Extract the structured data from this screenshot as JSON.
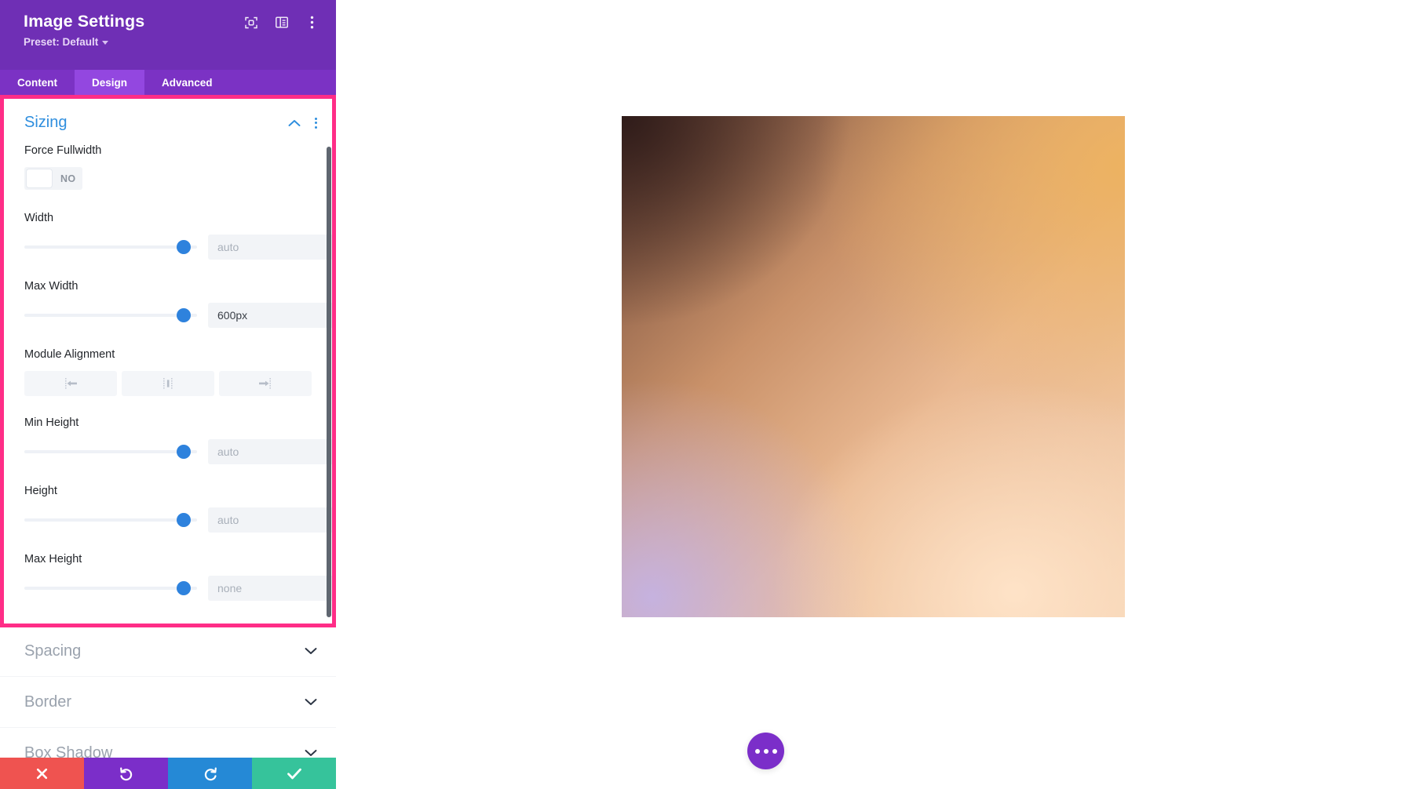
{
  "panel": {
    "title": "Image Settings",
    "preset_label": "Preset: Default",
    "header_icons": [
      {
        "name": "target-focus-icon"
      },
      {
        "name": "layout-panel-icon"
      },
      {
        "name": "kebab-menu-icon"
      }
    ],
    "tabs": [
      {
        "label": "Content",
        "active": false
      },
      {
        "label": "Design",
        "active": true
      },
      {
        "label": "Advanced",
        "active": false
      }
    ],
    "highlight_color": "#ff2d87",
    "accent_color": "#2e8ede",
    "header_color": "#6f2fb5"
  },
  "sizing": {
    "title": "Sizing",
    "collapse_icon": "chevron-up-icon",
    "menu_icon": "kebab-menu-icon",
    "fields": {
      "force_fullwidth": {
        "label": "Force Fullwidth",
        "toggle_value": "NO"
      },
      "width": {
        "label": "Width",
        "value": "",
        "placeholder": "auto",
        "slider_percent": 88
      },
      "max_width": {
        "label": "Max Width",
        "value": "600px",
        "placeholder": "",
        "slider_percent": 88
      },
      "module_alignment": {
        "label": "Module Alignment",
        "options": [
          {
            "name": "align-left-button",
            "icon": "align-left-icon"
          },
          {
            "name": "align-center-button",
            "icon": "align-center-icon"
          },
          {
            "name": "align-right-button",
            "icon": "align-right-icon"
          }
        ]
      },
      "min_height": {
        "label": "Min Height",
        "value": "",
        "placeholder": "auto",
        "slider_percent": 88
      },
      "height": {
        "label": "Height",
        "value": "",
        "placeholder": "auto",
        "slider_percent": 88
      },
      "max_height": {
        "label": "Max Height",
        "value": "",
        "placeholder": "none",
        "slider_percent": 88
      }
    }
  },
  "collapsed_sections": [
    {
      "title": "Spacing",
      "icon": "chevron-down-icon"
    },
    {
      "title": "Border",
      "icon": "chevron-down-icon"
    },
    {
      "title": "Box Shadow",
      "icon": "chevron-down-icon"
    }
  ],
  "action_bar": [
    {
      "name": "cancel-button",
      "icon": "close-x-icon",
      "color": "#ef5350"
    },
    {
      "name": "undo-button",
      "icon": "undo-arrow-icon",
      "color": "#7b2ec9"
    },
    {
      "name": "redo-button",
      "icon": "redo-arrow-icon",
      "color": "#2589d6"
    },
    {
      "name": "save-button",
      "icon": "checkmark-icon",
      "color": "#36c39b"
    }
  ],
  "canvas": {
    "preview_image_alt": "gradient-image-preview",
    "fab": {
      "name": "page-settings-fab",
      "icon": "ellipsis-horizontal-icon",
      "color": "#7b2ec9"
    }
  }
}
